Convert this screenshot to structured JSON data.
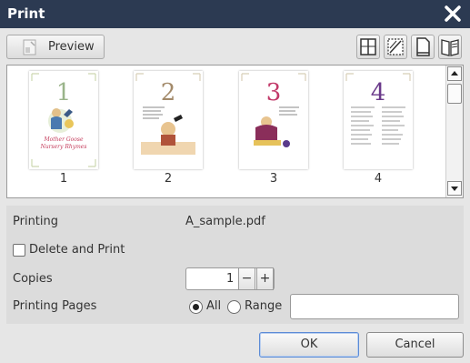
{
  "dialog": {
    "title": "Print"
  },
  "toolbar": {
    "preview_label": "Preview"
  },
  "pages": [
    {
      "label": "1",
      "numeral": "1",
      "numeral_color": "#9ab48a",
      "caption_lines": [
        "Mother Goose",
        "Nursery Rhymes"
      ]
    },
    {
      "label": "2",
      "numeral": "2",
      "numeral_color": "#a38a6a"
    },
    {
      "label": "3",
      "numeral": "3",
      "numeral_color": "#c23a6a"
    },
    {
      "label": "4",
      "numeral": "4",
      "numeral_color": "#6a3a8a"
    }
  ],
  "settings": {
    "printing_label": "Printing",
    "printing_value": "A_sample.pdf",
    "delete_and_print_label": "Delete and Print",
    "delete_and_print_checked": false,
    "copies_label": "Copies",
    "copies_value": "1",
    "minus_label": "−",
    "plus_label": "+",
    "printing_pages_label": "Printing Pages",
    "all_label": "All",
    "range_label": "Range",
    "range_value": "",
    "selected": "All"
  },
  "buttons": {
    "ok": "OK",
    "cancel": "Cancel"
  }
}
